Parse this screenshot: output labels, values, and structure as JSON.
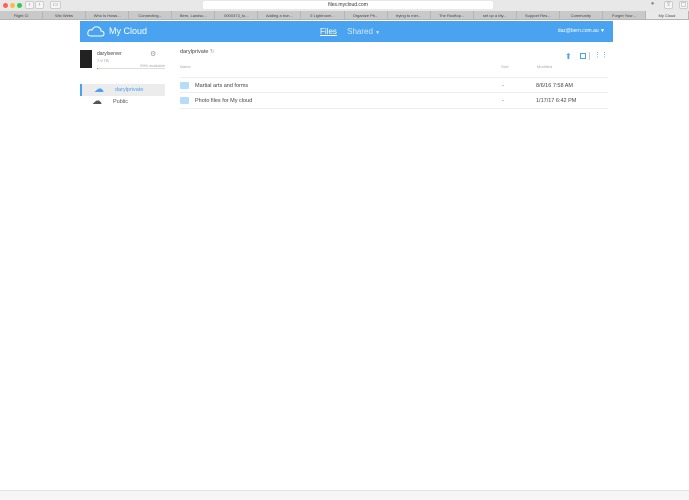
{
  "browser": {
    "url": "files.mycloud.com",
    "tabs": [
      "Flight Ci",
      "Wix Webs",
      "Who Is Hows...",
      "Connecting...",
      "Bern, Landsc...",
      "0000373_to...",
      "Adding a bon...",
      "5 Lightroom...",
      "Organize Ph...",
      "trying to mer...",
      "The Rooftop...",
      "set up a My...",
      "Support Res...",
      "Community",
      "Forget Your...",
      "My Cloud"
    ]
  },
  "header": {
    "logo": "My Cloud",
    "nav_files": "Files",
    "nav_shared": "Shared",
    "user": "daz@bern.com.au"
  },
  "sidebar": {
    "device_name": "darylserver",
    "capacity": "7.9 TB",
    "available": "99% available",
    "available_fraction": 0.99,
    "shares": [
      {
        "label": "darylprivate",
        "icon": "cloud-icon"
      },
      {
        "label": "Public",
        "icon": "public-cloud-icon"
      }
    ]
  },
  "main": {
    "breadcrumb": "darylprivate",
    "columns": {
      "name": "Name",
      "size": "Size",
      "modified": "Modified"
    },
    "rows": [
      {
        "name": "Martial arts and forms",
        "size": "-",
        "modified": "8/6/16 7:58 AM"
      },
      {
        "name": "Photo files for My cloud",
        "size": "-",
        "modified": "1/17/17 6:42 PM"
      }
    ]
  },
  "colors": {
    "accent": "#4aa3f0"
  }
}
